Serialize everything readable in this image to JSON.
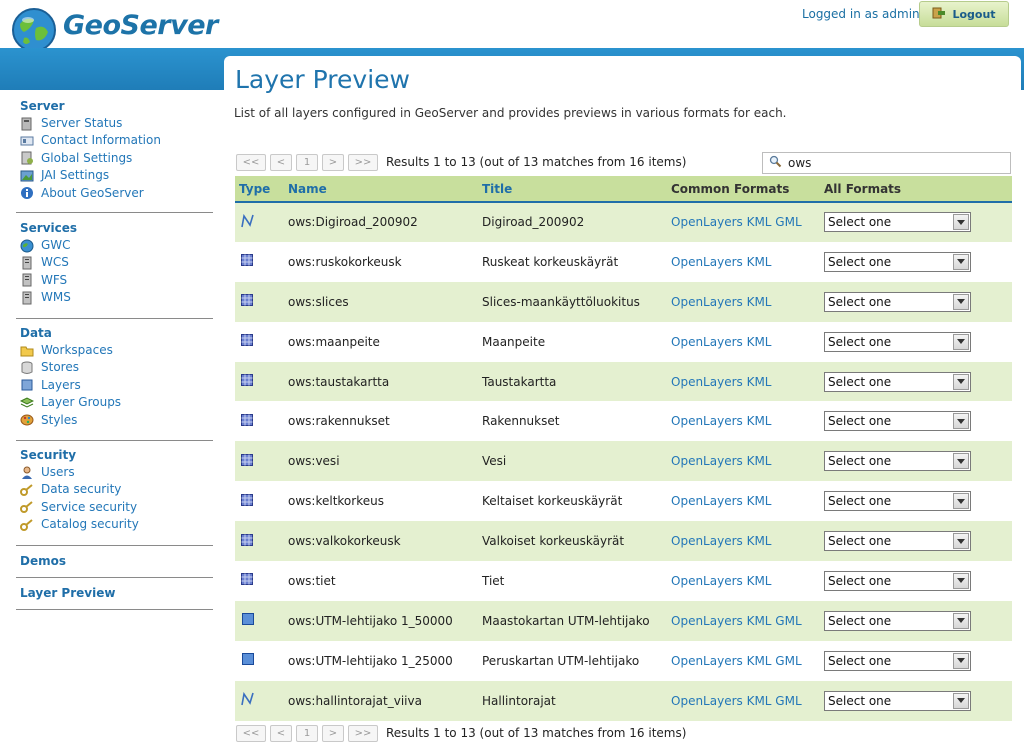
{
  "header": {
    "brand": "GeoServer",
    "logged_in": "Logged in as admin.",
    "logout_label": "Logout"
  },
  "sidebar": {
    "sections": [
      {
        "title": "Server",
        "items": [
          {
            "label": "Server Status",
            "icon": "server-status-icon"
          },
          {
            "label": "Contact Information",
            "icon": "contact-card-icon"
          },
          {
            "label": "Global Settings",
            "icon": "global-settings-icon"
          },
          {
            "label": "JAI Settings",
            "icon": "jai-settings-icon"
          },
          {
            "label": "About GeoServer",
            "icon": "info-icon"
          }
        ]
      },
      {
        "title": "Services",
        "items": [
          {
            "label": "GWC",
            "icon": "globe-icon"
          },
          {
            "label": "WCS",
            "icon": "server-icon"
          },
          {
            "label": "WFS",
            "icon": "server-icon"
          },
          {
            "label": "WMS",
            "icon": "server-icon"
          }
        ]
      },
      {
        "title": "Data",
        "items": [
          {
            "label": "Workspaces",
            "icon": "folder-icon"
          },
          {
            "label": "Stores",
            "icon": "database-icon"
          },
          {
            "label": "Layers",
            "icon": "layer-icon"
          },
          {
            "label": "Layer Groups",
            "icon": "layer-group-icon"
          },
          {
            "label": "Styles",
            "icon": "palette-icon"
          }
        ]
      },
      {
        "title": "Security",
        "items": [
          {
            "label": "Users",
            "icon": "user-icon"
          },
          {
            "label": "Data security",
            "icon": "key-icon"
          },
          {
            "label": "Service security",
            "icon": "key-icon"
          },
          {
            "label": "Catalog security",
            "icon": "key-icon"
          }
        ]
      },
      {
        "title": "Demos",
        "items": []
      },
      {
        "title": "Layer Preview",
        "items": []
      }
    ]
  },
  "main": {
    "title": "Layer Preview",
    "description": "List of all layers configured in GeoServer and provides previews in various formats for each.",
    "pager": {
      "first": "<<",
      "prev": "<",
      "page": "1",
      "next": ">",
      "last": ">>",
      "results": "Results 1 to 13 (out of 13 matches from 16 items)"
    },
    "search_value": "ows",
    "columns": [
      "Type",
      "Name",
      "Title",
      "Common Formats",
      "All Formats"
    ],
    "select_placeholder": "Select one",
    "rows": [
      {
        "type": "line",
        "name": "ows:Digiroad_200902",
        "title": "Digiroad_200902",
        "formats": "OpenLayers KML GML"
      },
      {
        "type": "raster",
        "name": "ows:ruskokorkeusk",
        "title": "Ruskeat korkeuskäyrät",
        "formats": "OpenLayers KML"
      },
      {
        "type": "raster",
        "name": "ows:slices",
        "title": "Slices-maankäyttöluokitus",
        "formats": "OpenLayers KML"
      },
      {
        "type": "raster",
        "name": "ows:maanpeite",
        "title": "Maanpeite",
        "formats": "OpenLayers KML"
      },
      {
        "type": "raster",
        "name": "ows:taustakartta",
        "title": "Taustakartta",
        "formats": "OpenLayers KML"
      },
      {
        "type": "raster",
        "name": "ows:rakennukset",
        "title": "Rakennukset",
        "formats": "OpenLayers KML"
      },
      {
        "type": "raster",
        "name": "ows:vesi",
        "title": "Vesi",
        "formats": "OpenLayers KML"
      },
      {
        "type": "raster",
        "name": "ows:keltkorkeus",
        "title": "Keltaiset korkeuskäyrät",
        "formats": "OpenLayers KML"
      },
      {
        "type": "raster",
        "name": "ows:valkokorkeusk",
        "title": "Valkoiset korkeuskäyrät",
        "formats": "OpenLayers KML"
      },
      {
        "type": "raster",
        "name": "ows:tiet",
        "title": "Tiet",
        "formats": "OpenLayers KML"
      },
      {
        "type": "polygon",
        "name": "ows:UTM-lehtijako 1_50000",
        "title": "Maastokartan UTM-lehtijako",
        "formats": "OpenLayers KML GML"
      },
      {
        "type": "polygon",
        "name": "ows:UTM-lehtijako 1_25000",
        "title": "Peruskartan UTM-lehtijako",
        "formats": "OpenLayers KML GML"
      },
      {
        "type": "line",
        "name": "ows:hallintorajat_viiva",
        "title": "Hallintorajat",
        "formats": "OpenLayers KML GML"
      }
    ]
  }
}
